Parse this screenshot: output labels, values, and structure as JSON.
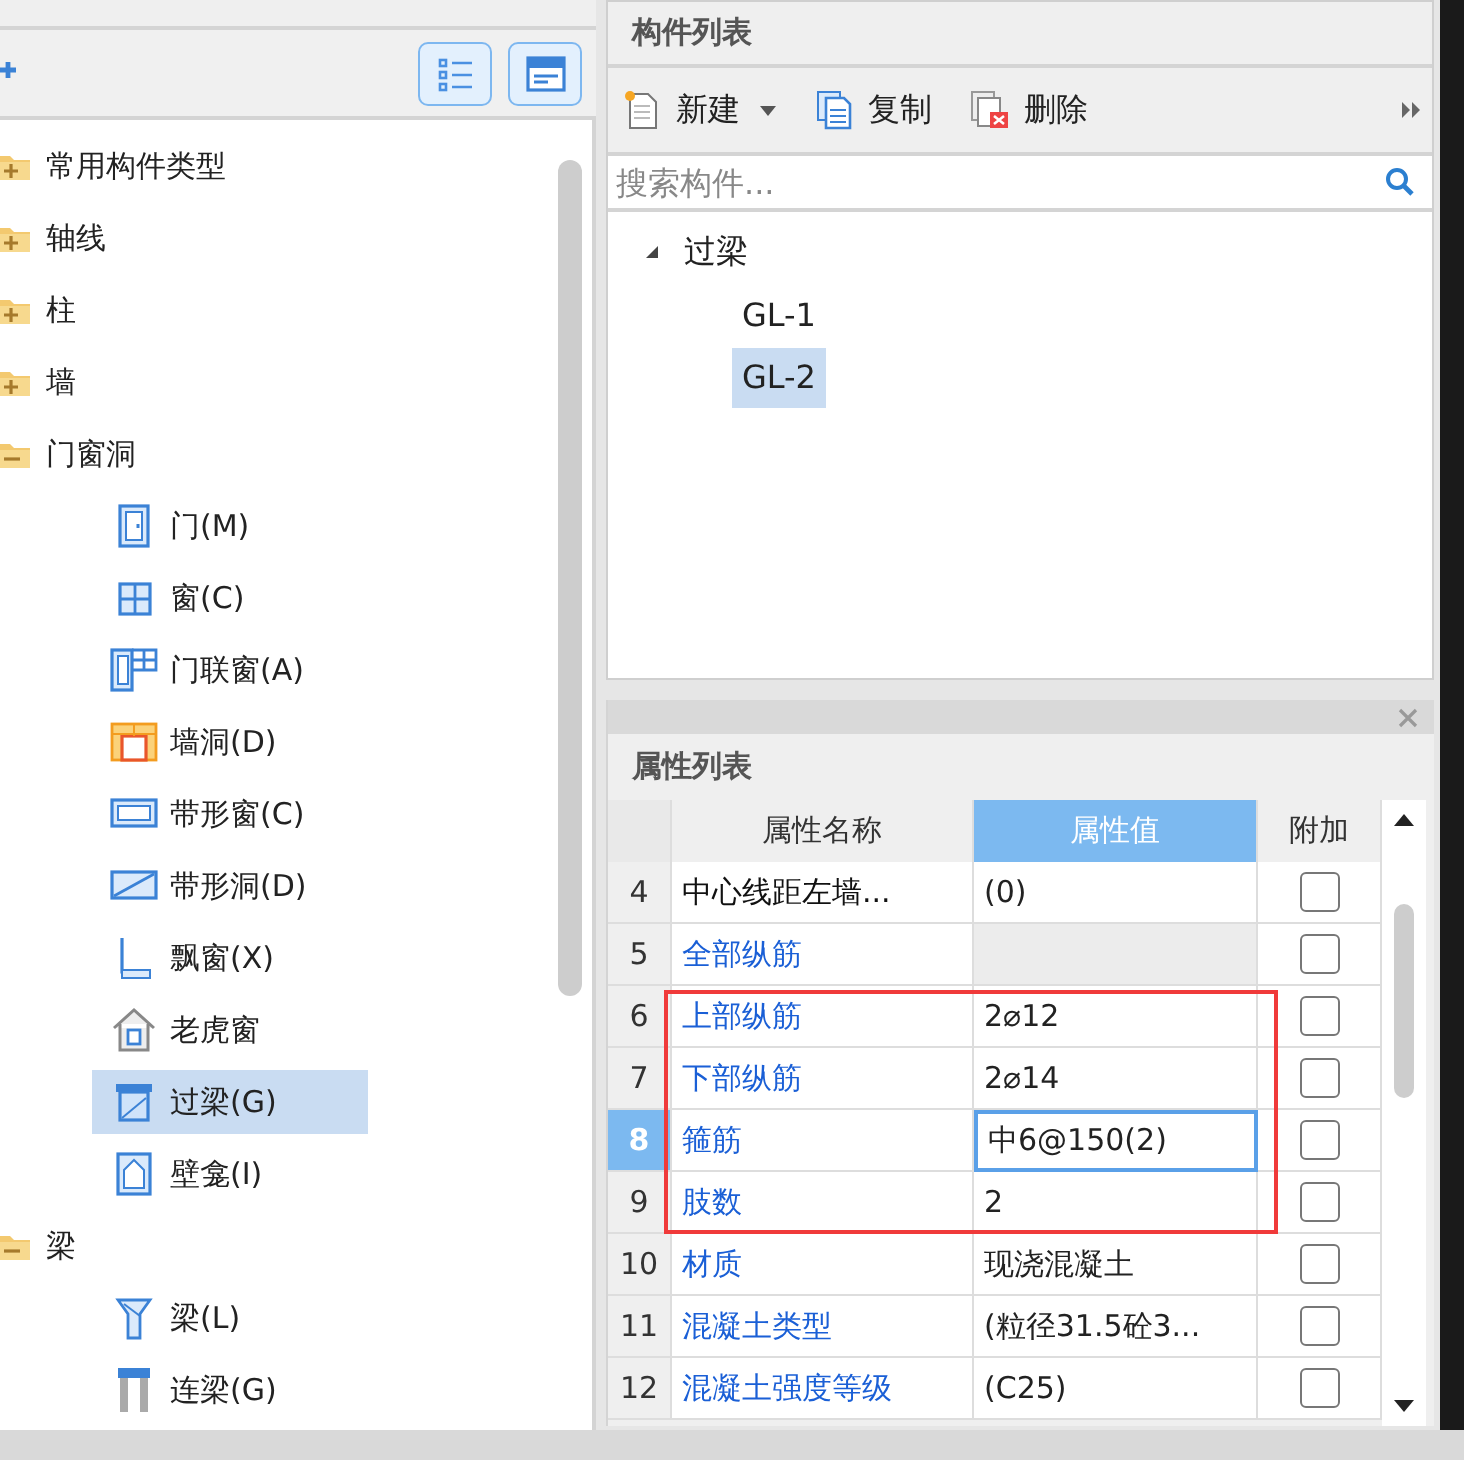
{
  "nav_tree": {
    "items": [
      {
        "label": "常用构件类型",
        "expanded": false
      },
      {
        "label": "轴线",
        "expanded": false
      },
      {
        "label": "柱",
        "expanded": false
      },
      {
        "label": "墙",
        "expanded": false
      },
      {
        "label": "门窗洞",
        "expanded": true,
        "children": [
          {
            "label": "门(M)",
            "selected": false
          },
          {
            "label": "窗(C)",
            "selected": false
          },
          {
            "label": "门联窗(A)",
            "selected": false
          },
          {
            "label": "墙洞(D)",
            "selected": false
          },
          {
            "label": "带形窗(C)",
            "selected": false
          },
          {
            "label": "带形洞(D)",
            "selected": false
          },
          {
            "label": "飘窗(X)",
            "selected": false
          },
          {
            "label": "老虎窗",
            "selected": false
          },
          {
            "label": "过梁(G)",
            "selected": true
          },
          {
            "label": "壁龛(I)",
            "selected": false
          }
        ]
      },
      {
        "label": "梁",
        "expanded": true,
        "children": [
          {
            "label": "梁(L)",
            "selected": false
          },
          {
            "label": "连梁(G)",
            "selected": false
          }
        ]
      }
    ]
  },
  "component_list": {
    "title": "构件列表",
    "toolbar": [
      {
        "label": "新建",
        "kind": "new"
      },
      {
        "label": "复制",
        "kind": "copy"
      },
      {
        "label": "删除",
        "kind": "delete"
      }
    ],
    "search": {
      "placeholder": "搜索构件..."
    },
    "tree": {
      "label": "过梁",
      "expanded": true,
      "children": [
        {
          "label": "GL-1",
          "selected": false
        },
        {
          "label": "GL-2",
          "selected": true
        }
      ]
    }
  },
  "property_list": {
    "title": "属性列表",
    "columns": [
      {
        "label": "属性名称",
        "selected": false
      },
      {
        "label": "属性值",
        "selected": true
      },
      {
        "label": "附加",
        "selected": false
      }
    ],
    "rows": [
      {
        "number": "4",
        "name": "中心线距左墙...",
        "value": "(0)",
        "editable": false,
        "value_disabled": false,
        "selected": false,
        "checked": false,
        "highlighted": false
      },
      {
        "number": "5",
        "name": "全部纵筋",
        "value": "",
        "editable": true,
        "value_disabled": true,
        "selected": false,
        "checked": false,
        "highlighted": false
      },
      {
        "number": "6",
        "name": "上部纵筋",
        "value": "2⌀12",
        "editable": true,
        "value_disabled": false,
        "selected": false,
        "checked": false,
        "highlighted": true
      },
      {
        "number": "7",
        "name": "下部纵筋",
        "value": "2⌀14",
        "editable": true,
        "value_disabled": false,
        "selected": false,
        "checked": false,
        "highlighted": true
      },
      {
        "number": "8",
        "name": "箍筋",
        "value": "中6@150(2)",
        "editable": true,
        "value_disabled": false,
        "selected": true,
        "checked": false,
        "highlighted": true
      },
      {
        "number": "9",
        "name": "肢数",
        "value": "2",
        "editable": true,
        "value_disabled": false,
        "selected": false,
        "checked": false,
        "highlighted": true
      },
      {
        "number": "10",
        "name": "材质",
        "value": "现浇混凝土",
        "editable": true,
        "value_disabled": false,
        "selected": false,
        "checked": false,
        "highlighted": false
      },
      {
        "number": "11",
        "name": "混凝土类型",
        "value": "(粒径31.5砼3...",
        "editable": true,
        "value_disabled": false,
        "selected": false,
        "checked": false,
        "highlighted": false
      },
      {
        "number": "12",
        "name": "混凝土强度等级",
        "value": "(C25)",
        "editable": true,
        "value_disabled": false,
        "selected": false,
        "checked": false,
        "highlighted": false
      }
    ]
  }
}
